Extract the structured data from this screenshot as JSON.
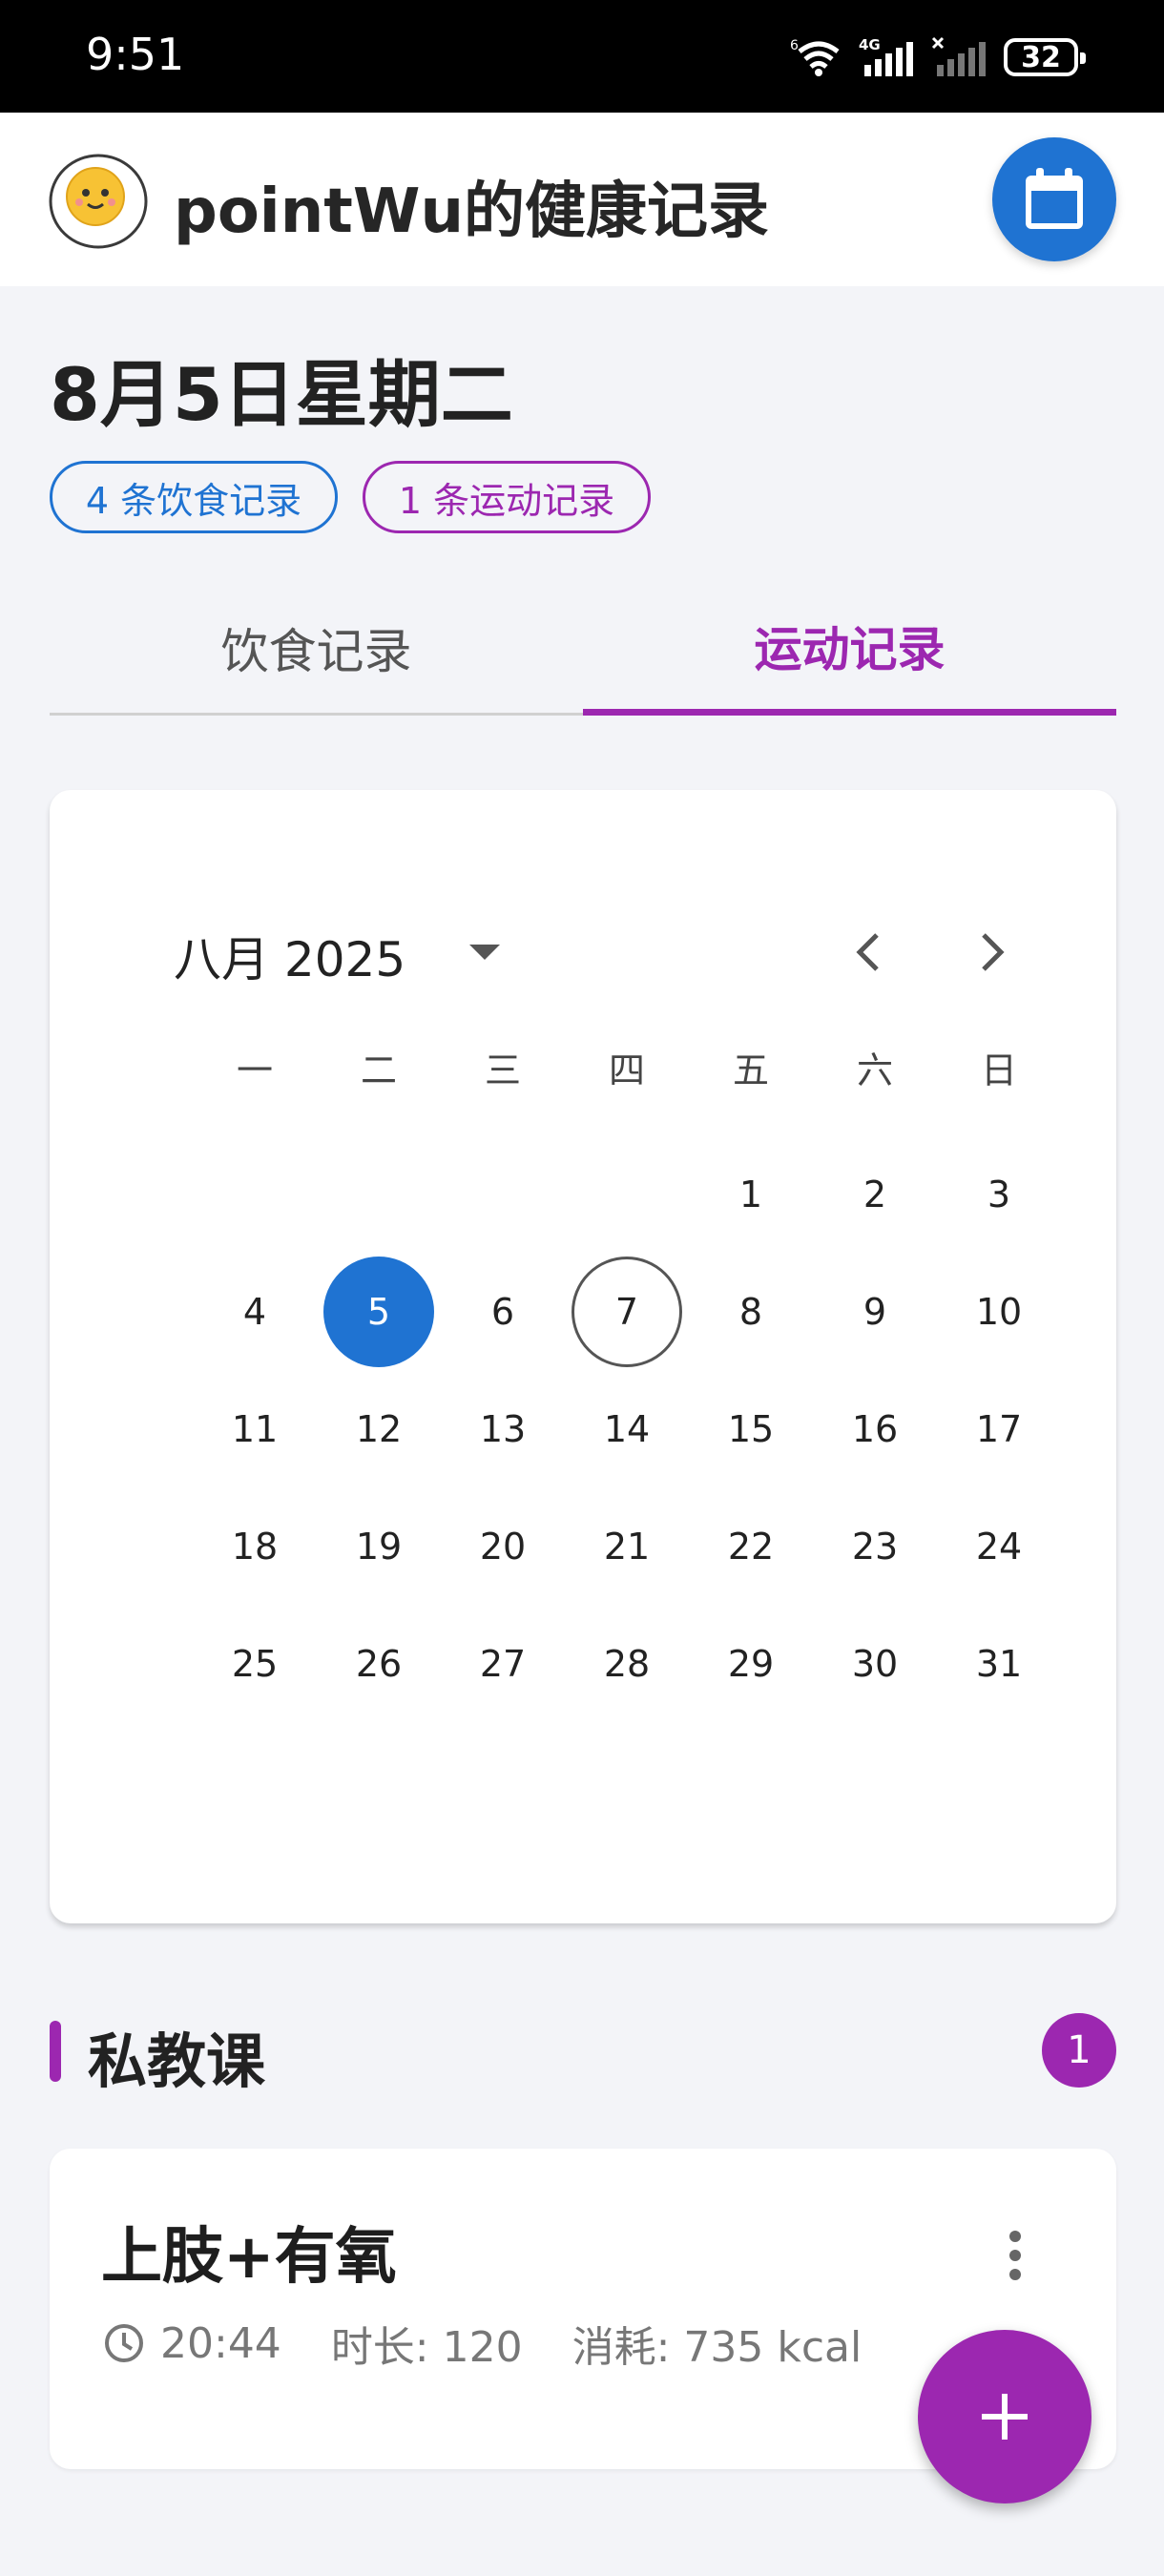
{
  "status_bar": {
    "time": "9:51",
    "battery": "32",
    "icons": [
      "wifi-icon",
      "signal-4g-icon",
      "signal-empty-icon",
      "battery-icon"
    ]
  },
  "app_bar": {
    "title": "pointWu的健康记录",
    "logo_icon": "egg-face-logo",
    "calendar_button_icon": "calendar-icon",
    "accent": "#1f73d2"
  },
  "summary": {
    "date": "8月5日星期二",
    "food_chip": "4 条饮食记录",
    "exercise_chip": "1 条运动记录"
  },
  "tabs": {
    "items": [
      {
        "label": "饮食记录",
        "active": false
      },
      {
        "label": "运动记录",
        "active": true
      }
    ],
    "active_color": "#9c27b0"
  },
  "calendar": {
    "month_label": "八月 2025",
    "weekdays": [
      "一",
      "二",
      "三",
      "四",
      "五",
      "六",
      "日"
    ],
    "leading_blanks": 4,
    "days_in_month": 31,
    "selected_day": 5,
    "today": 7
  },
  "section": {
    "title": "私教课",
    "count": "1"
  },
  "record": {
    "title": "上肢+有氧",
    "time": "20:44",
    "duration": "时长: 120",
    "calories": "消耗: 735 kcal"
  },
  "fab": {
    "icon": "plus-icon",
    "color": "#9c27b0"
  }
}
